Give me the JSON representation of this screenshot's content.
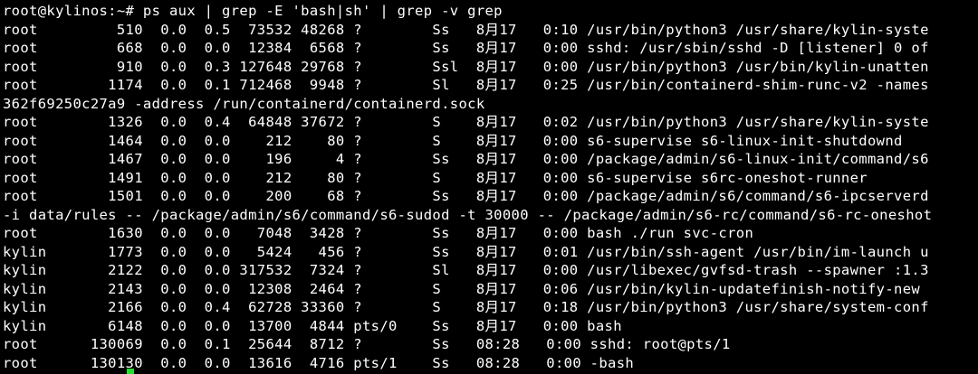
{
  "terminal": {
    "prompt": "root@kylinos:~#",
    "command": "ps aux | grep -E 'bash|sh' | grep -v grep",
    "cursor_color": "#22e02e",
    "lines": [
      "root@kylinos:~# ps aux | grep -E 'bash|sh' | grep -v grep",
      "root         510  0.0  0.5  73532 48268 ?        Ss   8月17   0:10 /usr/bin/python3 /usr/share/kylin-syste",
      "root         668  0.0  0.0  12384  6568 ?        Ss   8月17   0:00 sshd: /usr/sbin/sshd -D [listener] 0 of",
      "root         910  0.0  0.3 127648 29768 ?        Ssl  8月17   0:00 /usr/bin/python3 /usr/bin/kylin-unatten",
      "root        1174  0.0  0.1 712468  9948 ?        Sl   8月17   0:25 /usr/bin/containerd-shim-runc-v2 -names",
      "362f69250c27a9 -address /run/containerd/containerd.sock",
      "root        1326  0.0  0.4  64848 37672 ?        S    8月17   0:02 /usr/bin/python3 /usr/share/kylin-syste",
      "root        1464  0.0  0.0    212    80 ?        S    8月17   0:00 s6-supervise s6-linux-init-shutdownd",
      "root        1467  0.0  0.0    196     4 ?        Ss   8月17   0:00 /package/admin/s6-linux-init/command/s6",
      "root        1491  0.0  0.0    212    80 ?        S    8月17   0:00 s6-supervise s6rc-oneshot-runner",
      "root        1501  0.0  0.0    200    68 ?        Ss   8月17   0:00 /package/admin/s6/command/s6-ipcserverd",
      "-i data/rules -- /package/admin/s6/command/s6-sudod -t 30000 -- /package/admin/s6-rc/command/s6-rc-oneshot",
      "root        1630  0.0  0.0   7048  3428 ?        Ss   8月17   0:00 bash ./run svc-cron",
      "kylin       1773  0.0  0.0   5424   456 ?        Ss   8月17   0:01 /usr/bin/ssh-agent /usr/bin/im-launch u",
      "kylin       2122  0.0  0.0 317532  7324 ?        Sl   8月17   0:00 /usr/libexec/gvfsd-trash --spawner :1.3",
      "kylin       2143  0.0  0.0  12308  2464 ?        S    8月17   0:06 /usr/bin/kylin-updatefinish-notify-new",
      "kylin       2166  0.0  0.4  62728 33360 ?        S    8月17   0:18 /usr/bin/python3 /usr/share/system-conf",
      "kylin       6148  0.0  0.0  13700  4844 pts/0    Ss   8月17   0:00 bash",
      "root      130069  0.0  0.1  25644  8712 ?        Ss   08:28   0:00 sshd: root@pts/1",
      "root      130130  0.0  0.0  13616  4716 pts/1    Ss   08:28   0:00 -bash"
    ]
  }
}
